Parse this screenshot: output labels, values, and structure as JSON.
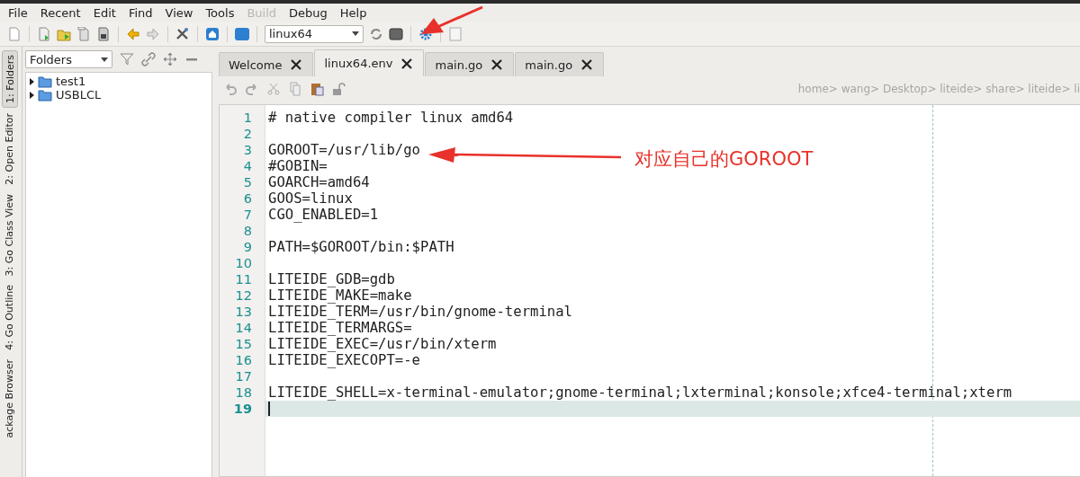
{
  "menu": [
    {
      "label": "File",
      "disabled": false
    },
    {
      "label": "Recent",
      "disabled": false
    },
    {
      "label": "Edit",
      "disabled": false
    },
    {
      "label": "Find",
      "disabled": false
    },
    {
      "label": "View",
      "disabled": false
    },
    {
      "label": "Tools",
      "disabled": false
    },
    {
      "label": "Build",
      "disabled": true
    },
    {
      "label": "Debug",
      "disabled": false
    },
    {
      "label": "Help",
      "disabled": false
    }
  ],
  "toolbar": {
    "environment": "linux64"
  },
  "side_tabs": [
    {
      "label": "1: Folders",
      "selected": true
    },
    {
      "label": "2: Open Editor",
      "selected": false
    },
    {
      "label": "3: Go Class View",
      "selected": false
    },
    {
      "label": "4: Go Outline",
      "selected": false
    },
    {
      "label": "ackage Browser",
      "selected": false
    }
  ],
  "folder_panel": {
    "view": "Folders",
    "tree": [
      {
        "label": "test1",
        "expanded": false
      },
      {
        "label": "USBLCL",
        "expanded": false
      }
    ]
  },
  "editor_tabs": [
    {
      "label": "Welcome",
      "selected": false
    },
    {
      "label": "linux64.env",
      "selected": true
    },
    {
      "label": "main.go",
      "selected": false
    },
    {
      "label": "main.go",
      "selected": false
    }
  ],
  "breadcrumb": "home> wang> Desktop> liteide> share> liteide> li",
  "lines": [
    {
      "number": "1",
      "text": "# native compiler linux amd64",
      "current": false
    },
    {
      "number": "2",
      "current": false
    },
    {
      "number": "3",
      "text": "GOROOT=/usr/lib/go",
      "current": false
    },
    {
      "number": "4",
      "text": "#GOBIN=",
      "current": false
    },
    {
      "number": "5",
      "text": "GOARCH=amd64",
      "current": false
    },
    {
      "number": "6",
      "text": "GOOS=linux",
      "current": false
    },
    {
      "number": "7",
      "text": "CGO_ENABLED=1",
      "current": false
    },
    {
      "number": "8",
      "current": false
    },
    {
      "number": "9",
      "text": "PATH=$GOROOT/bin:$PATH",
      "current": false
    },
    {
      "number": "10",
      "current": false
    },
    {
      "number": "11",
      "text": "LITEIDE_GDB=gdb",
      "current": false
    },
    {
      "number": "12",
      "text": "LITEIDE_MAKE=make",
      "current": false
    },
    {
      "number": "13",
      "text": "LITEIDE_TERM=/usr/bin/gnome-terminal",
      "current": false
    },
    {
      "number": "14",
      "text": "LITEIDE_TERMARGS=",
      "current": false
    },
    {
      "number": "15",
      "text": "LITEIDE_EXEC=/usr/bin/xterm",
      "current": false
    },
    {
      "number": "16",
      "text": "LITEIDE_EXECOPT=-e",
      "current": false
    },
    {
      "number": "17",
      "current": false
    },
    {
      "number": "18",
      "text": "LITEIDE_SHELL=x-terminal-emulator;gnome-terminal;lxterminal;konsole;xfce4-terminal;xterm",
      "current": false
    },
    {
      "number": "19",
      "current": true
    }
  ],
  "annotation": {
    "text": "对应自己的GOROOT"
  }
}
